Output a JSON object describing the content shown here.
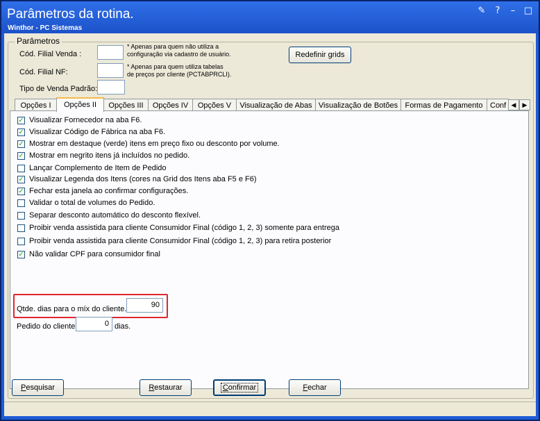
{
  "window": {
    "title": "Parâmetros da rotina.",
    "subtitle": "Winthor - PC Sistemas"
  },
  "params_group": {
    "legend": "Parâmetros",
    "filial_venda_label": "Cód. Filial Venda :",
    "filial_venda_value": "",
    "filial_venda_note_1": "* Apenas para quem não utiliza a",
    "filial_venda_note_2": "configuração via cadastro de usuário.",
    "filial_nf_label": "Cód. Filial NF:",
    "filial_nf_value": "",
    "filial_nf_note_1": "* Apenas para quem utiliza tabelas",
    "filial_nf_note_2": "de preços por cliente (PCTABPRCLI).",
    "tipo_venda_label": "Tipo de Venda Padrão:",
    "tipo_venda_value": "",
    "redefinir_label": "Redefinir grids"
  },
  "tabs": [
    {
      "label": "Opções I"
    },
    {
      "label": "Opções II"
    },
    {
      "label": "Opções III"
    },
    {
      "label": "Opções IV"
    },
    {
      "label": "Opções V"
    },
    {
      "label": "Visualização de Abas"
    },
    {
      "label": "Visualização de Botões"
    },
    {
      "label": "Formas de Pagamento"
    },
    {
      "label": "Conf"
    }
  ],
  "options": [
    {
      "label": "Visualizar Fornecedor na aba F6.",
      "checked": true
    },
    {
      "label": "Visualizar Código de Fábrica na aba F6.",
      "checked": true
    },
    {
      "label": "Mostrar em destaque (verde) itens em preço fixo ou desconto por volume.",
      "checked": true
    },
    {
      "label": "Mostrar em negrito itens já incluídos no pedido.",
      "checked": true
    },
    {
      "label": "Lançar Complemento de Item de Pedido",
      "checked": false
    },
    {
      "label": "Visualizar Legenda dos Itens (cores na Grid dos Itens aba F5 e F6)",
      "checked": true
    },
    {
      "label": "Fechar esta janela ao confirmar configurações.",
      "checked": true
    },
    {
      "label": "Validar o total de volumes do Pedido.",
      "checked": false
    },
    {
      "label": "Separar desconto automático do desconto flexível.",
      "checked": false
    },
    {
      "label": "Proibir venda assistida para cliente Consumidor Final (código 1, 2, 3) somente para entrega",
      "checked": false
    },
    {
      "label": "Proibir venda assistida para cliente Consumidor Final (código 1, 2, 3)  para retira posterior",
      "checked": false
    },
    {
      "label": "Não validar CPF para consumidor final",
      "checked": true
    }
  ],
  "qtde_dias": {
    "label": "Qtde. dias para o míx do cliente.",
    "value": "90"
  },
  "pedido_cliente": {
    "label": "Pedido do cliente",
    "value": "0",
    "suffix": "dias."
  },
  "buttons": {
    "pesquisar_first": "P",
    "pesquisar_rest": "esquisar",
    "restaurar_first": "R",
    "restaurar_rest": "estaurar",
    "confirmar_first": "C",
    "confirmar_rest": "onfirmar",
    "fechar_first": "F",
    "fechar_rest": "echar"
  },
  "colors": {
    "titlebar": "#1c52c9",
    "face": "#ece9d8",
    "highlight_border": "#e0262c",
    "check": "#21a121"
  }
}
